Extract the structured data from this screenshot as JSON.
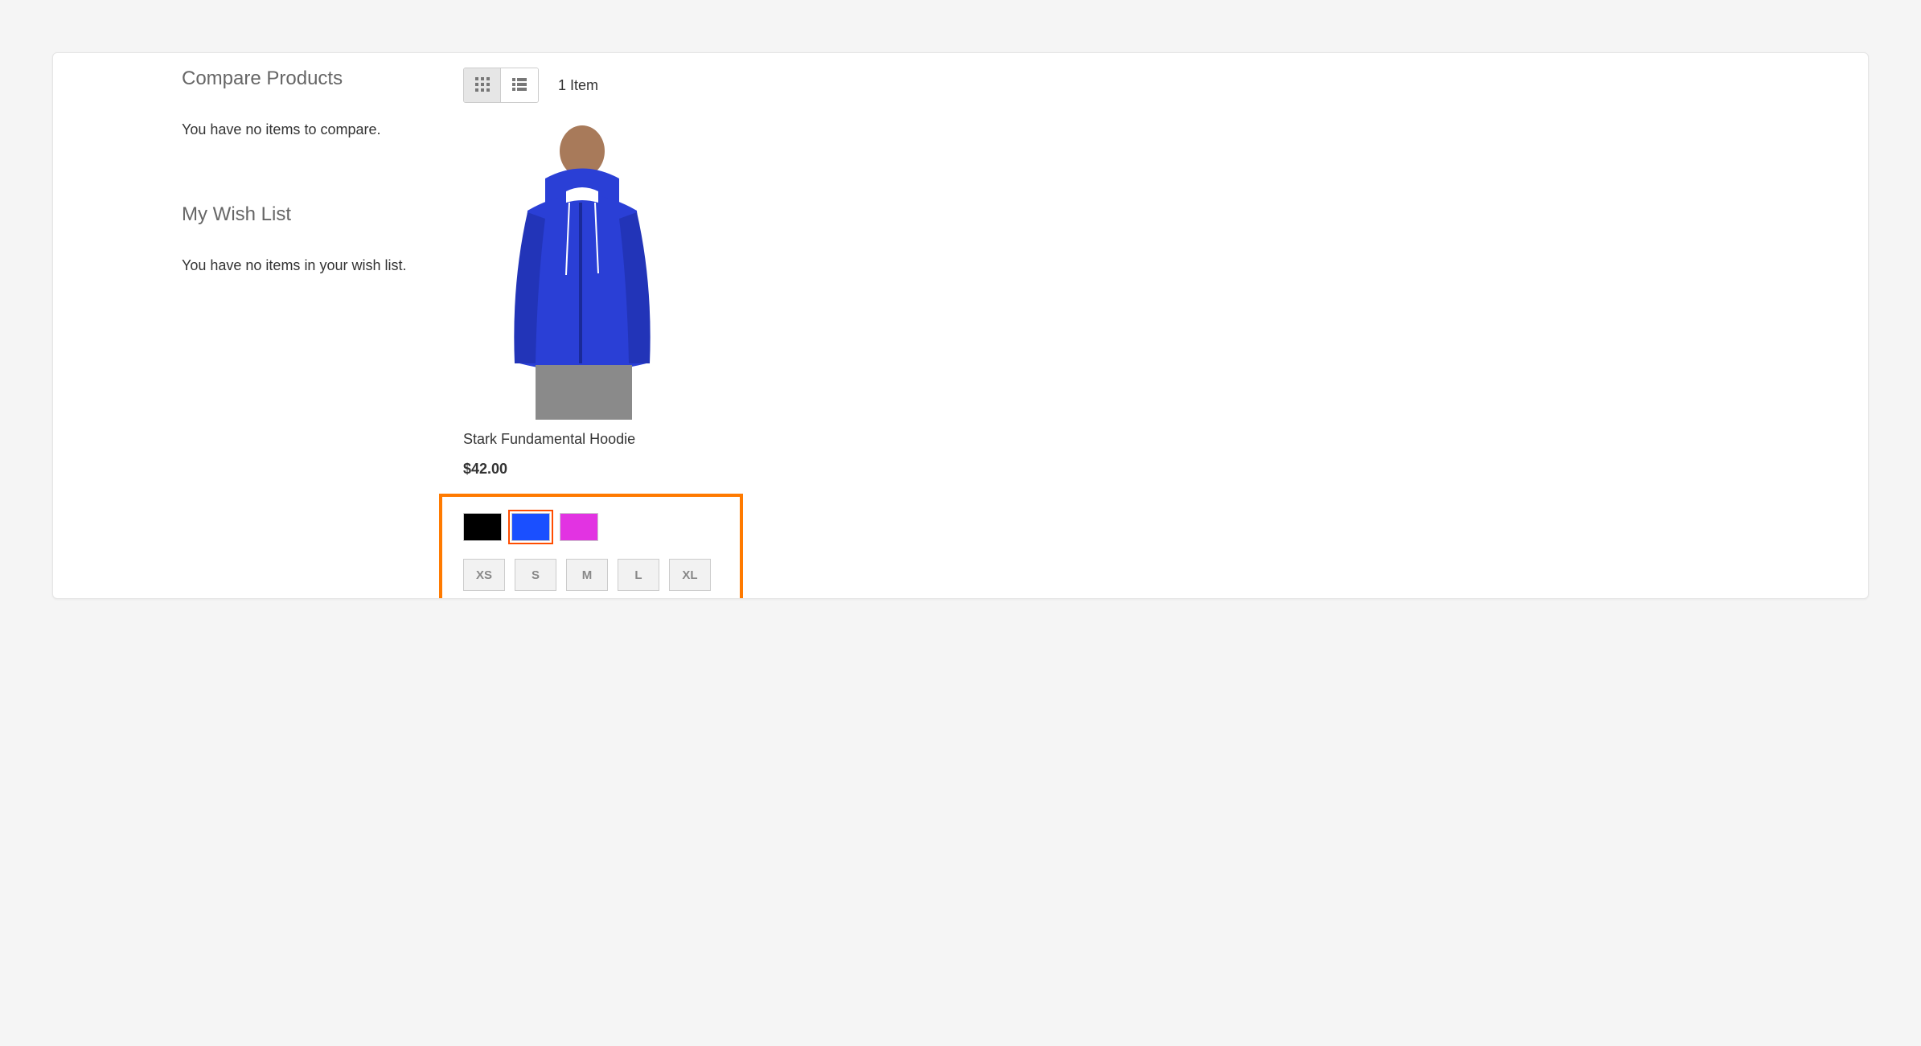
{
  "sidebar": {
    "compare": {
      "title": "Compare Products",
      "empty": "You have no items to compare."
    },
    "wishlist": {
      "title": "My Wish List",
      "empty": "You have no items in your wish list."
    }
  },
  "toolbar": {
    "item_count": "1 Item"
  },
  "product": {
    "name": "Stark Fundamental Hoodie",
    "price": "$42.00",
    "colors": [
      {
        "hex": "#000000",
        "name": "black",
        "selected": false
      },
      {
        "hex": "#1a4fff",
        "name": "blue",
        "selected": true
      },
      {
        "hex": "#e233e2",
        "name": "pink",
        "selected": false
      }
    ],
    "sizes": [
      "XS",
      "S",
      "M",
      "L",
      "XL"
    ]
  }
}
